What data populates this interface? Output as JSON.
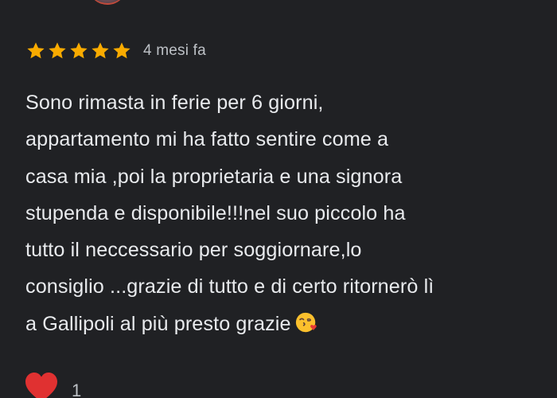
{
  "review": {
    "rating": 5,
    "rating_max": 5,
    "star_icon": "star-icon",
    "star_color": "#f9ab00",
    "time_ago": "4 mesi fa",
    "text_lines": [
      "Sono rimasta in ferie per 6 giorni,",
      "appartamento mi ha fatto sentire come a",
      "casa mia ,poi la proprietaria e una signora",
      "stupenda e disponibile!!!nel suo piccolo ha",
      "tutto il neccessario per soggiornare,lo",
      "consiglio ...grazie di tutto e di certo ritornerò lì",
      "a Gallipoli al più presto grazie"
    ],
    "emoji_icon": "face-blowing-kiss-icon"
  },
  "reactions": {
    "heart_icon": "heart-icon",
    "heart_color": "#e03131",
    "count": "1"
  },
  "colors": {
    "background": "#202124",
    "text": "#e8eaed",
    "muted_text": "#bdc1c6"
  }
}
